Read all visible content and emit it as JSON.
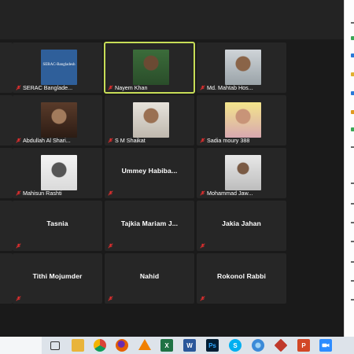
{
  "meeting": {
    "participants": [
      {
        "name": "",
        "video": false,
        "muted": false
      },
      {
        "name": "SERAC Banglade...",
        "video": true,
        "muted": true,
        "logo_text": "SERAC-Bangladesh"
      },
      {
        "name": "Nayem Khan",
        "video": true,
        "muted": true,
        "active_speaker": true
      },
      {
        "name": "Md. Mahtab Hos...",
        "video": true,
        "muted": true
      },
      {
        "name": "",
        "video": false,
        "muted": false
      },
      {
        "name": "Abdullah Al Shari...",
        "video": true,
        "muted": true
      },
      {
        "name": "S M Shaikat",
        "video": true,
        "muted": true
      },
      {
        "name": "Sadia moury 388",
        "video": true,
        "muted": true
      },
      {
        "name": "",
        "video": false,
        "muted": false
      },
      {
        "name": "Mahisun Rashti",
        "video": true,
        "muted": true
      },
      {
        "name": "Ummey Habiba...",
        "video": false,
        "muted": true
      },
      {
        "name": "Mohammad Jaw...",
        "video": true,
        "muted": true
      },
      {
        "name": "",
        "video": false,
        "muted": false
      },
      {
        "name": "Tasnia",
        "video": false,
        "muted": true
      },
      {
        "name": "Tajkia Mariam J...",
        "video": false,
        "muted": true
      },
      {
        "name": "Jakia Jahan",
        "video": false,
        "muted": true
      },
      {
        "name": "",
        "video": false,
        "muted": false
      },
      {
        "name": "Tithi Mojumder",
        "video": false,
        "muted": true
      },
      {
        "name": "Nahid",
        "video": false,
        "muted": true
      },
      {
        "name": "Rokonol Rabbi",
        "video": false,
        "muted": true
      }
    ]
  },
  "taskbar": {
    "icons": [
      {
        "name": "task-view-icon",
        "label": ""
      },
      {
        "name": "file-explorer-icon",
        "label": ""
      },
      {
        "name": "chrome-icon",
        "label": ""
      },
      {
        "name": "firefox-icon",
        "label": ""
      },
      {
        "name": "vlc-icon",
        "label": ""
      },
      {
        "name": "excel-icon",
        "label": "X"
      },
      {
        "name": "word-icon",
        "label": "W"
      },
      {
        "name": "photoshop-icon",
        "label": "Ps"
      },
      {
        "name": "skype-icon",
        "label": "S"
      },
      {
        "name": "network-icon",
        "label": ""
      },
      {
        "name": "app-icon",
        "label": ""
      },
      {
        "name": "powerpoint-icon",
        "label": "P"
      },
      {
        "name": "zoom-icon",
        "label": ""
      }
    ]
  },
  "colors": {
    "zoom_background": "#1a1a1a",
    "tile_background": "#262626",
    "active_speaker_border": "#c7dd57",
    "mute_icon": "#e02f2f",
    "taskbar": "#dde3ea"
  }
}
